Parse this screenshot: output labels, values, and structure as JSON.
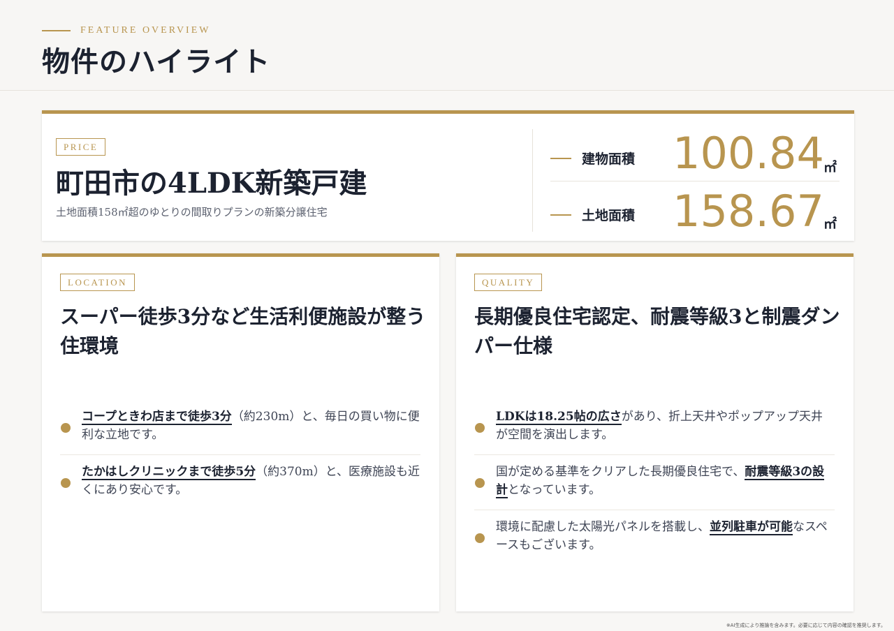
{
  "header": {
    "eyebrow": "FEATURE OVERVIEW",
    "title": "物件のハイライト"
  },
  "price_card": {
    "tag": "PRICE",
    "title": "町田市の4LDK新築戸建",
    "subtitle": "土地面積158㎡超のゆとりの間取りプランの新築分譲住宅",
    "stats": [
      {
        "label": "建物面積",
        "value": "100.84",
        "unit": "㎡"
      },
      {
        "label": "土地面積",
        "value": "158.67",
        "unit": "㎡"
      }
    ]
  },
  "location_card": {
    "tag": "LOCATION",
    "title": "スーパー徒歩3分など生活利便施設が整う住環境",
    "items": [
      {
        "highlight": "コープときわ店まで徒歩3分",
        "rest": "（約230m）と、毎日の買い物に便利な立地です。"
      },
      {
        "highlight": "たかはしクリニックまで徒歩5分",
        "rest": "（約370m）と、医療施設も近くにあり安心です。"
      }
    ]
  },
  "quality_card": {
    "tag": "QUALITY",
    "title": "長期優良住宅認定、耐震等級3と制震ダンパー仕様",
    "items": [
      {
        "pre": "",
        "highlight": "LDKは18.25帖の広さ",
        "rest": "があり、折上天井やポップアップ天井が空間を演出します。"
      },
      {
        "pre": "国が定める基準をクリアした長期優良住宅で、",
        "highlight": "耐震等級3の設計",
        "rest": "となっています。"
      },
      {
        "pre": "環境に配慮した太陽光パネルを搭載し、",
        "highlight": "並列駐車が可能",
        "rest": "なスペースもございます。"
      }
    ]
  },
  "footnote": "※AI生成により推論を含みます。必要に応じて内容の確認を推奨します。",
  "colors": {
    "accent": "#b8954f",
    "text": "#1c2230",
    "background": "#f8f7f5"
  }
}
